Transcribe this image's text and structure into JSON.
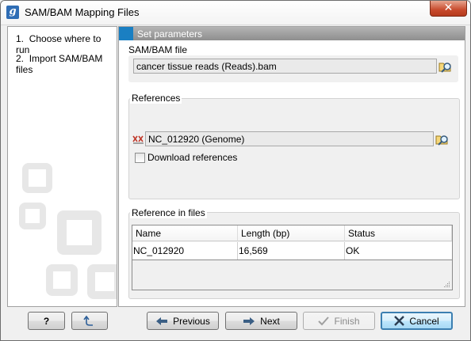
{
  "window": {
    "title": "SAM/BAM Mapping Files",
    "app_icon_letter": "g",
    "close_glyph": "✕"
  },
  "steps": [
    {
      "number": "1.",
      "label": "Choose where to run"
    },
    {
      "number": "2.",
      "label": "Import SAM/BAM files"
    }
  ],
  "panel": {
    "title": "Set parameters",
    "accent_color": "#1a7fc2"
  },
  "sambam": {
    "group_label": "SAM/BAM file",
    "value": "cancer tissue reads (Reads).bam",
    "browse_icon": "folder-search-icon"
  },
  "references": {
    "group_label": "References",
    "value": "NC_012920 (Genome)",
    "sequence_icon": "genome-sequence-icon",
    "browse_icon": "folder-search-icon",
    "download_label": "Download references",
    "download_checked": false
  },
  "ref_files": {
    "group_label": "Reference in files",
    "columns": [
      "Name",
      "Length (bp)",
      "Status"
    ],
    "rows": [
      [
        "NC_012920",
        "16,569",
        "OK"
      ]
    ]
  },
  "buttons": {
    "help": "?",
    "reset_icon": "reset-arrow-icon",
    "previous": "Previous",
    "next": "Next",
    "finish": "Finish",
    "cancel": "Cancel"
  }
}
